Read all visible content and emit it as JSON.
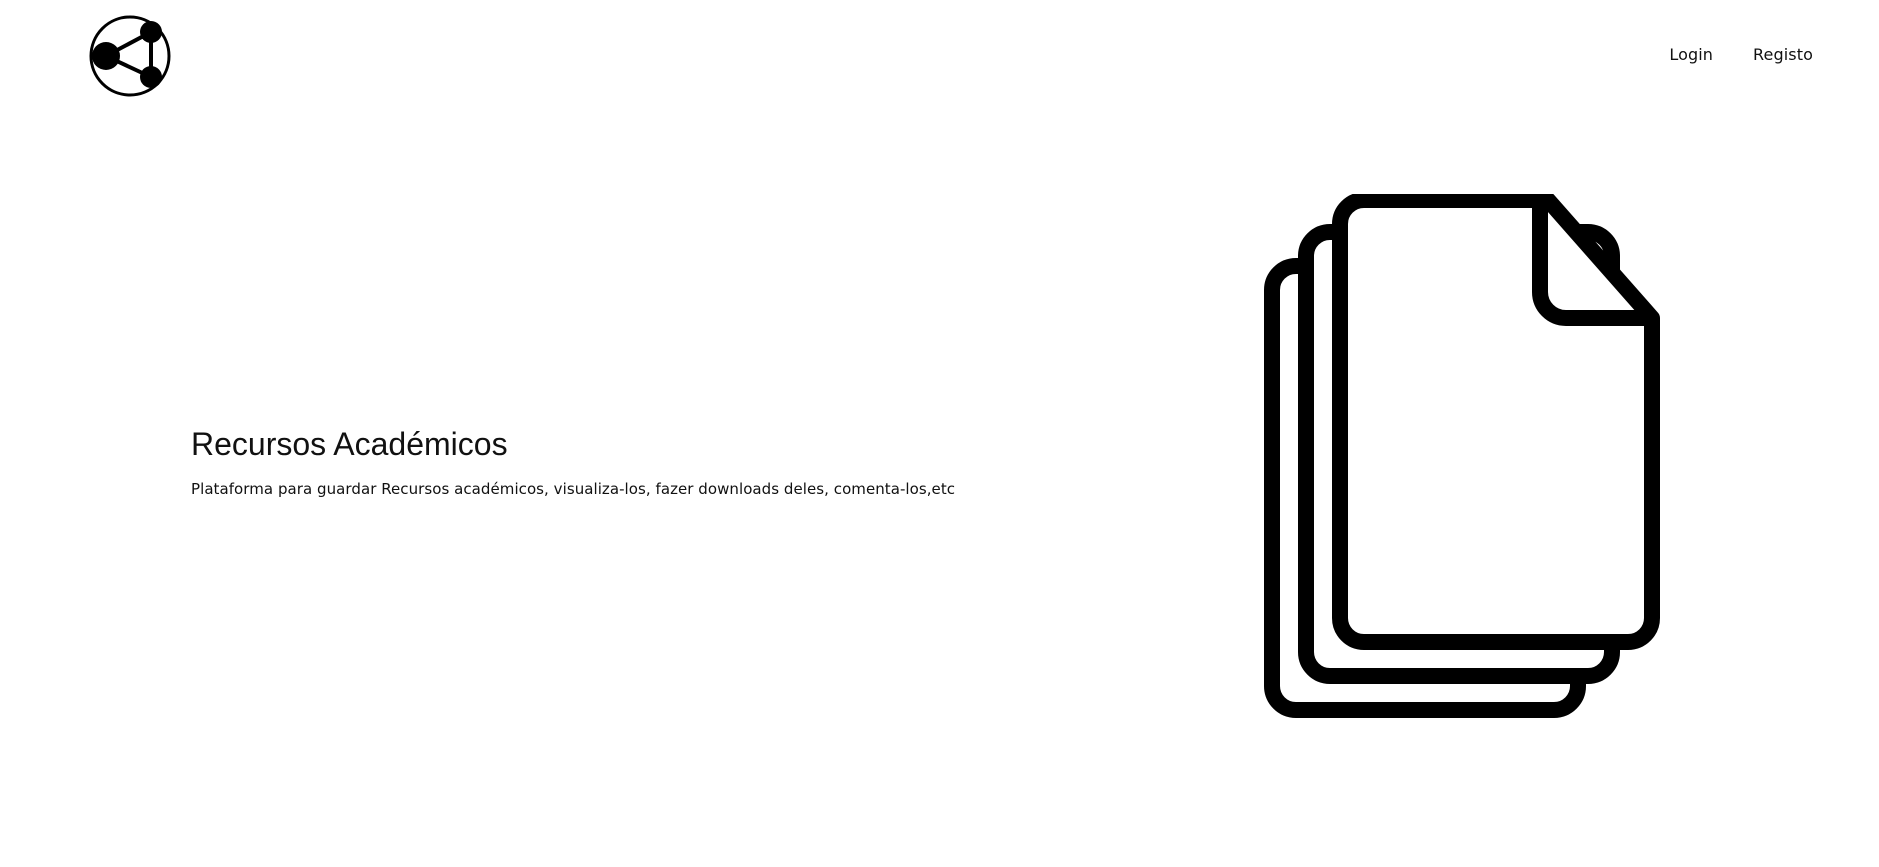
{
  "header": {
    "logo_icon": "share-circle-icon",
    "nav": [
      {
        "label": "Login"
      },
      {
        "label": "Registo"
      }
    ]
  },
  "hero": {
    "title": "Recursos Académicos",
    "subtitle": "Plataforma para guardar Recursos académicos, visualiza-los, fazer downloads deles, comenta-los,etc",
    "illustration_icon": "stacked-documents-icon"
  },
  "colors": {
    "background": "#ffffff",
    "foreground": "#000000"
  }
}
